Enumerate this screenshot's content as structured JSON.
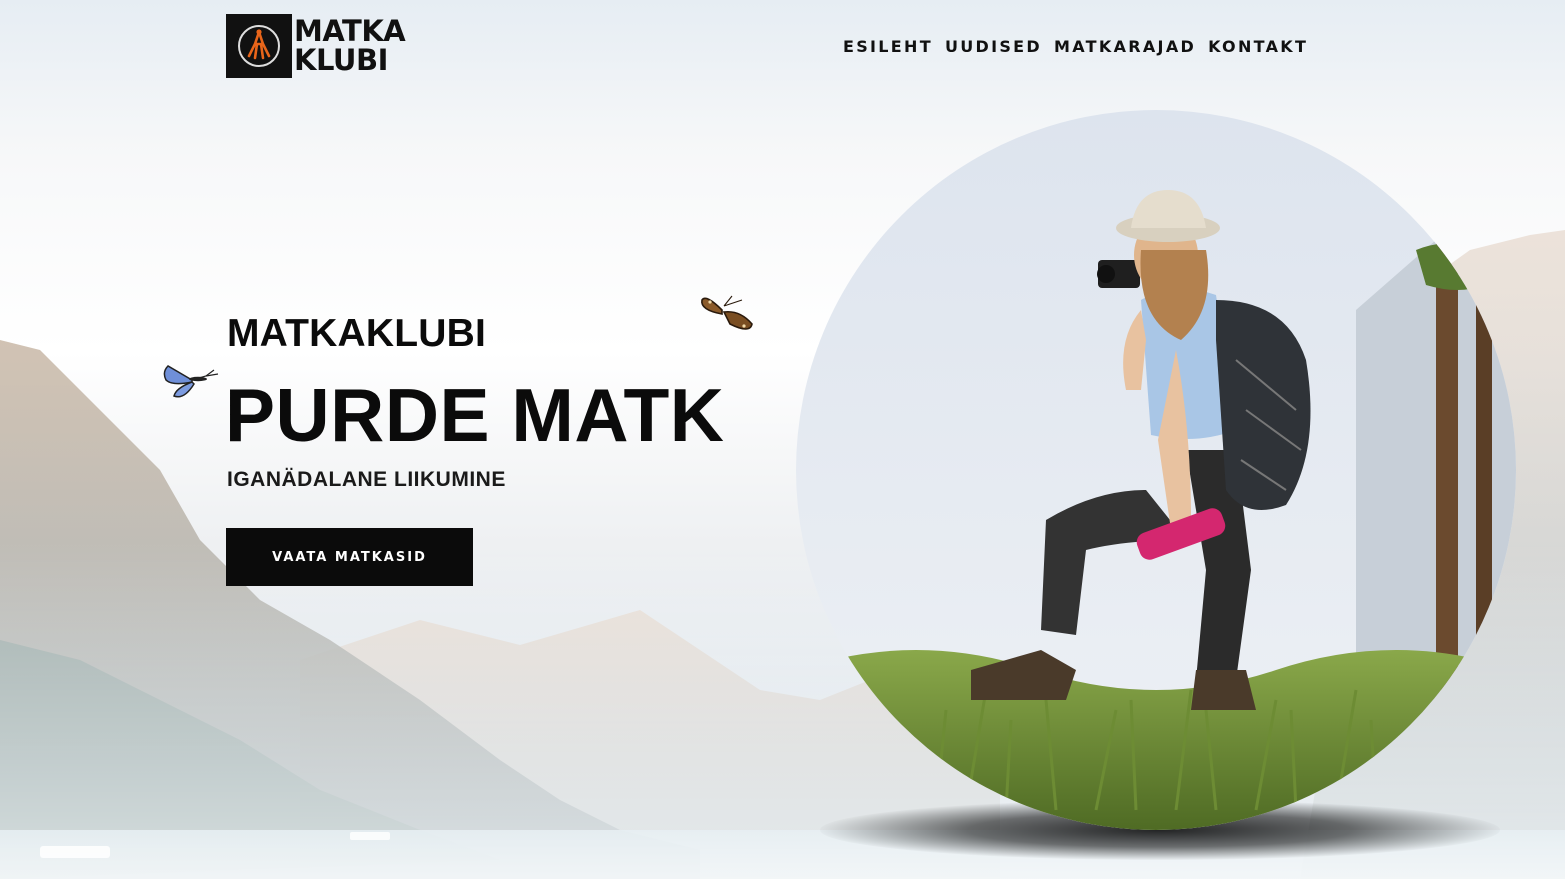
{
  "brand": {
    "logo_line1": "MATKA",
    "logo_line2": "KLUBI"
  },
  "nav": {
    "items": [
      "ESILEHT",
      "UUDISED",
      "MATKARAJAD",
      "KONTAKT"
    ]
  },
  "hero": {
    "kicker": "MATKAKLUBI",
    "title": "PURDE MATK",
    "subtitle": "IGANÄDALANE LIIKUMINE",
    "cta_label": "VAATA MATKASID"
  },
  "icons": {
    "logo": "hiker-logo-icon",
    "butterfly_left": "butterfly-icon",
    "butterfly_right": "butterfly-icon"
  },
  "colors": {
    "text": "#0b0b0b",
    "button_bg": "#0b0b0b",
    "button_text": "#ffffff",
    "logo_accent": "#e8651a"
  }
}
